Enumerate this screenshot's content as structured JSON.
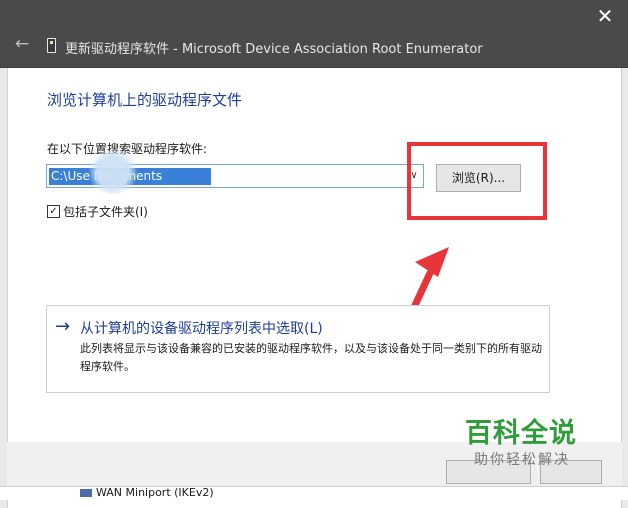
{
  "window": {
    "title": "更新驱动程序软件 - Microsoft Device Association Root Enumerator",
    "back_icon": "back-arrow-icon",
    "close_icon": "close-icon"
  },
  "main": {
    "heading": "浏览计算机上的驱动程序文件",
    "search_label": "在以下位置搜索驱动程序软件:",
    "path_value": "C:\\Use           Documents",
    "browse_button": "浏览(R)...",
    "include_subfolders": {
      "label": "包括子文件夹(I)",
      "checked": true
    }
  },
  "pick_option": {
    "title": "从计算机的设备驱动程序列表中选取(L)",
    "description": "此列表将显示与该设备兼容的已安装的驱动程序软件，以及与该设备处于同一类别下的所有驱动程序软件。"
  },
  "watermark": {
    "title": "百科全说",
    "subtitle": "助你轻松解决"
  },
  "background_window": {
    "item_text": "WAN Miniport (IKEv2)"
  },
  "colors": {
    "titlebar": "#4a4a4a",
    "link_blue": "#1f3d99",
    "selection": "#3a7fd8",
    "annotation_red": "#e8353a",
    "watermark_green": "#2f9e3a"
  }
}
